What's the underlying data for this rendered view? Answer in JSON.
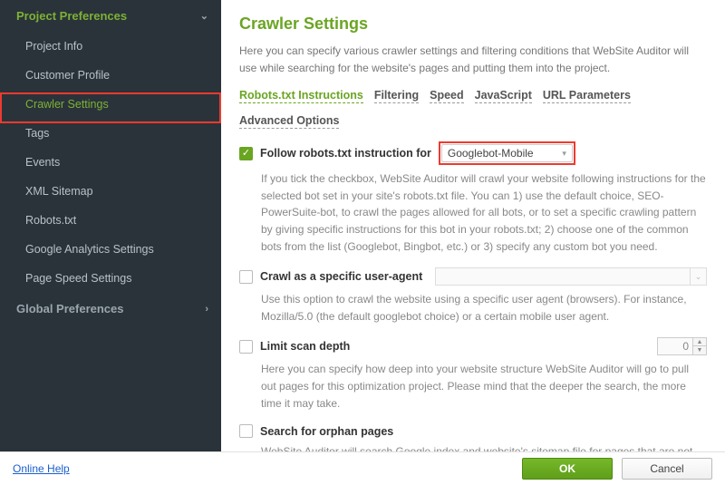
{
  "sidebar": {
    "section1": {
      "title": "Project Preferences"
    },
    "items": [
      {
        "label": "Project Info"
      },
      {
        "label": "Customer Profile"
      },
      {
        "label": "Crawler Settings"
      },
      {
        "label": "Tags"
      },
      {
        "label": "Events"
      },
      {
        "label": "XML Sitemap"
      },
      {
        "label": "Robots.txt"
      },
      {
        "label": "Google Analytics Settings"
      },
      {
        "label": "Page Speed Settings"
      }
    ],
    "section2": {
      "title": "Global Preferences"
    }
  },
  "main": {
    "title": "Crawler Settings",
    "intro": "Here you can specify various crawler settings and filtering conditions that WebSite Auditor will use while searching for the website's pages and putting them into the project.",
    "tabs": [
      {
        "label": "Robots.txt Instructions"
      },
      {
        "label": "Filtering"
      },
      {
        "label": "Speed"
      },
      {
        "label": "JavaScript"
      },
      {
        "label": "URL Parameters"
      },
      {
        "label": "Advanced Options"
      }
    ],
    "opt_follow": {
      "label": "Follow robots.txt instruction for",
      "select_value": "Googlebot-Mobile",
      "desc": "If you tick the checkbox, WebSite Auditor will crawl your website following instructions for the selected bot set in your site's robots.txt file. You can 1) use the default choice, SEO-PowerSuite-bot, to crawl the pages allowed for all bots, or to set a specific crawling pattern by giving specific instructions for this bot in your robots.txt; 2) choose one of the common bots from the list (Googlebot, Bingbot, etc.) or 3) specify any custom bot you need."
    },
    "opt_agent": {
      "label": "Crawl as a specific user-agent",
      "desc": "Use this option to crawl the website using a specific user agent (browsers). For instance, Mozilla/5.0 (the default googlebot choice) or a certain mobile user agent."
    },
    "opt_depth": {
      "label": "Limit scan depth",
      "value": "0",
      "desc": "Here you can specify how deep into your website structure WebSite Auditor will go to pull out pages for this optimization project. Please mind that the deeper the search, the more time it may take."
    },
    "opt_orphan": {
      "label": "Search for orphan pages",
      "desc": "WebSite Auditor will search Google index and website's sitemap file for pages that are not linked from other pages of your website."
    }
  },
  "footer": {
    "help": "Online Help",
    "ok": "OK",
    "cancel": "Cancel"
  }
}
